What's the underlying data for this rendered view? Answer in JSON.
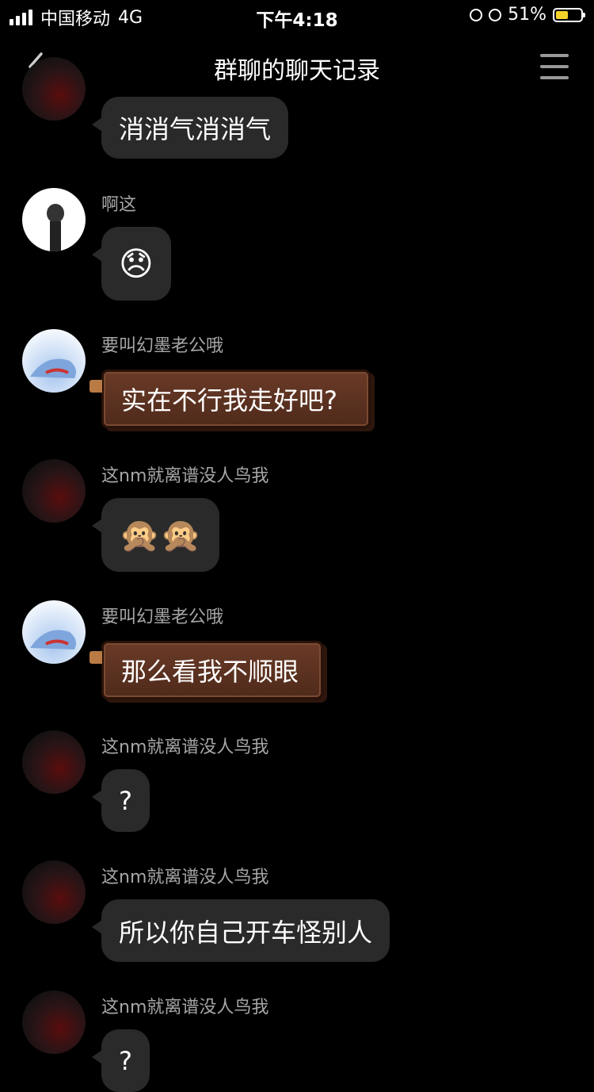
{
  "status_bar": {
    "carrier": "中国移动",
    "network": "4G",
    "time": "下午4:18",
    "battery_percent": "51%",
    "battery_level": 0.51,
    "battery_color": "#f5d22a"
  },
  "nav": {
    "title": "群聊的聊天记录",
    "back_icon": "chevron-left-icon",
    "menu_icon": "hamburger-menu-icon"
  },
  "messages": [
    {
      "sender": "",
      "text": "消消气消消气",
      "style": "default"
    },
    {
      "sender": "啊这",
      "text": "😞",
      "style": "default"
    },
    {
      "sender": "要叫幻墨老公哦",
      "text": "实在不行我走好吧?",
      "style": "chocolate"
    },
    {
      "sender": "这nm就离谱没人鸟我",
      "text": "🙊🙊",
      "style": "default"
    },
    {
      "sender": "要叫幻墨老公哦",
      "text": "那么看我不顺眼",
      "style": "chocolate"
    },
    {
      "sender": "这nm就离谱没人鸟我",
      "text": "?",
      "style": "default"
    },
    {
      "sender": "这nm就离谱没人鸟我",
      "text": "所以你自己开车怪别人",
      "style": "default"
    },
    {
      "sender": "这nm就离谱没人鸟我",
      "text": "?",
      "style": "default"
    }
  ]
}
